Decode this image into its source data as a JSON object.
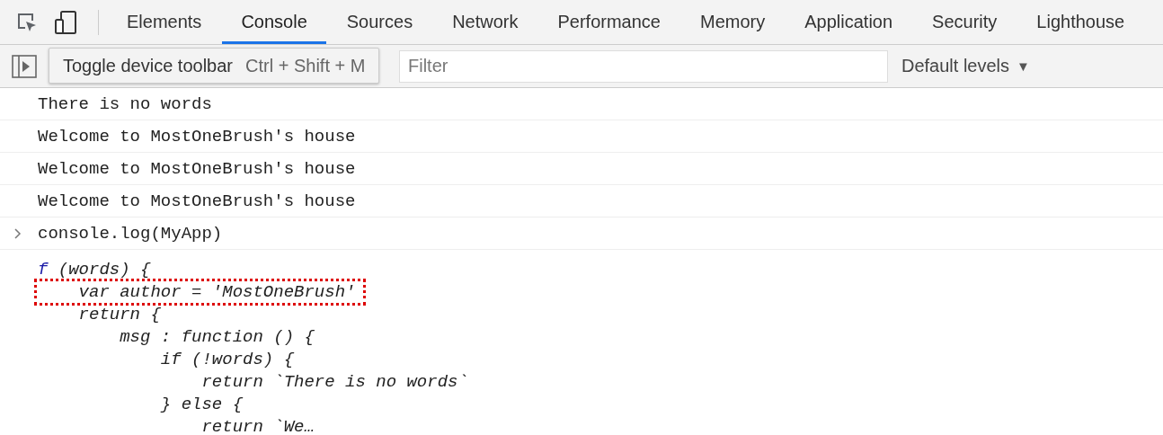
{
  "tabs": [
    {
      "label": "Elements",
      "selected": false
    },
    {
      "label": "Console",
      "selected": true
    },
    {
      "label": "Sources",
      "selected": false
    },
    {
      "label": "Network",
      "selected": false
    },
    {
      "label": "Performance",
      "selected": false
    },
    {
      "label": "Memory",
      "selected": false
    },
    {
      "label": "Application",
      "selected": false
    },
    {
      "label": "Security",
      "selected": false
    },
    {
      "label": "Lighthouse",
      "selected": false
    }
  ],
  "tooltip": {
    "label": "Toggle device toolbar",
    "shortcut": "Ctrl + Shift + M"
  },
  "filter": {
    "placeholder": "Filter"
  },
  "levels": {
    "label": "Default levels",
    "caret": "▼"
  },
  "messages": [
    {
      "kind": "log",
      "text": "There is no words"
    },
    {
      "kind": "log",
      "text": "Welcome to MostOneBrush's house"
    },
    {
      "kind": "log",
      "text": "Welcome to MostOneBrush's house"
    },
    {
      "kind": "log",
      "text": "Welcome to MostOneBrush's house"
    },
    {
      "kind": "input",
      "text": "console.log(MyApp)"
    }
  ],
  "result": {
    "keyword": "f",
    "lines": [
      {
        "text": " (words) {",
        "highlighted": false
      },
      {
        "text": "    var author = 'MostOneBrush'",
        "highlighted": true
      },
      {
        "text": "    return {",
        "highlighted": false
      },
      {
        "text": "        msg : function () {",
        "highlighted": false
      },
      {
        "text": "            if (!words) {",
        "highlighted": false
      },
      {
        "text": "                return `There is no words`",
        "highlighted": false
      },
      {
        "text": "            } else {",
        "highlighted": false
      },
      {
        "text": "                return `We…",
        "highlighted": false
      }
    ]
  }
}
